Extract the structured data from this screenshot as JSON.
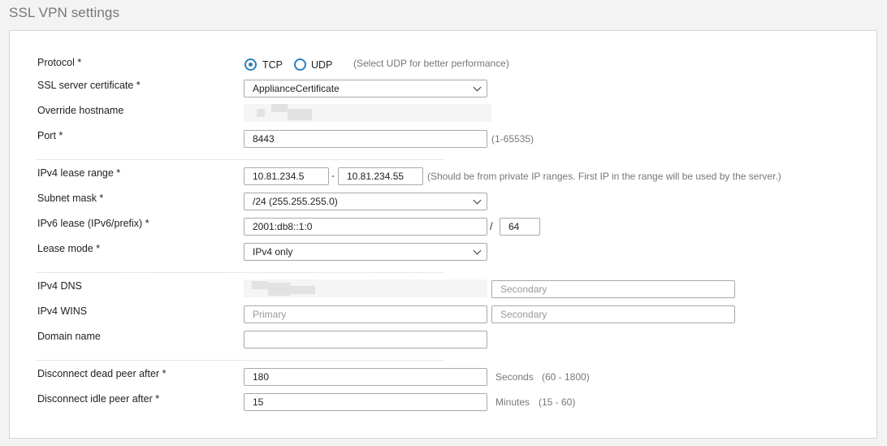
{
  "page_title": "SSL VPN settings",
  "protocol": {
    "label": "Protocol *",
    "tcp": "TCP",
    "udp": "UDP",
    "selected": "TCP",
    "hint": "(Select UDP for better performance)"
  },
  "certificate": {
    "label": "SSL server certificate *",
    "value": "ApplianceCertificate"
  },
  "override_hostname": {
    "label": "Override hostname"
  },
  "port": {
    "label": "Port *",
    "value": "8443",
    "hint": "(1-65535)"
  },
  "ipv4_lease": {
    "label": "IPv4 lease range *",
    "start": "10.81.234.5",
    "dash": "-",
    "end": "10.81.234.55",
    "hint": "(Should be from private IP ranges. First IP in the range will be used by the server.)"
  },
  "subnet_mask": {
    "label": "Subnet mask *",
    "value": "/24 (255.255.255.0)"
  },
  "ipv6_lease": {
    "label": "IPv6 lease (IPv6/prefix) *",
    "value": "2001:db8::1:0",
    "slash": "/",
    "prefix": "64"
  },
  "lease_mode": {
    "label": "Lease mode *",
    "value": "IPv4 only"
  },
  "ipv4_dns": {
    "label": "IPv4 DNS",
    "secondary_placeholder": "Secondary"
  },
  "ipv4_wins": {
    "label": "IPv4 WINS",
    "primary_placeholder": "Primary",
    "secondary_placeholder": "Secondary"
  },
  "domain_name": {
    "label": "Domain name",
    "value": ""
  },
  "dead_peer": {
    "label": "Disconnect dead peer after *",
    "value": "180",
    "unit": "Seconds",
    "range": "(60 - 1800)"
  },
  "idle_peer": {
    "label": "Disconnect idle peer after *",
    "value": "15",
    "unit": "Minutes",
    "range": "(15 - 60)"
  },
  "colors": {
    "accent": "#2b7fbf",
    "border": "#a9a9a9",
    "background": "#f3f3f3"
  }
}
